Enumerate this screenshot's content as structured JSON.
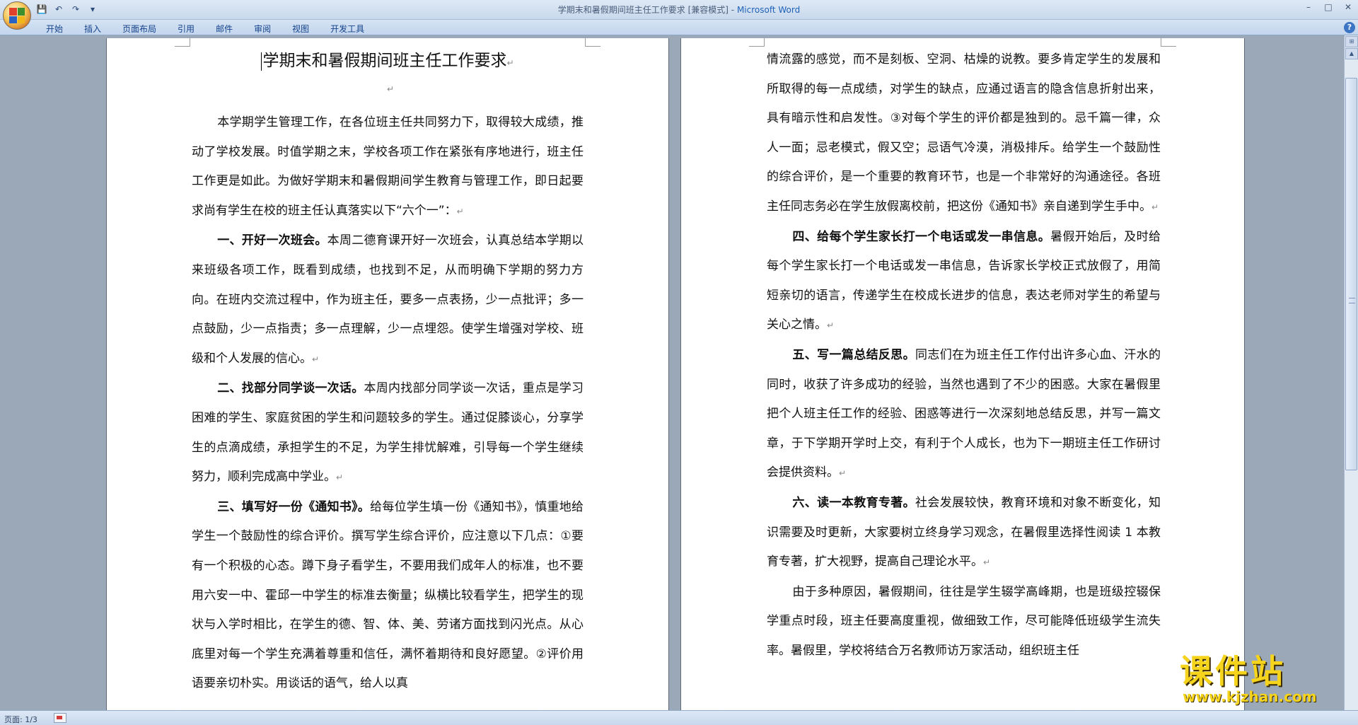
{
  "window": {
    "title_doc": "学期末和暑假期间班主任工作要求 [兼容模式]",
    "title_sep": " - ",
    "title_app": "Microsoft Word",
    "controls": [
      "–",
      "□",
      "✕"
    ]
  },
  "ribbon": {
    "tabs": [
      "开始",
      "插入",
      "页面布局",
      "引用",
      "邮件",
      "审阅",
      "视图",
      "开发工具"
    ],
    "help": "?"
  },
  "document": {
    "title": "学期末和暑假期间班主任工作要求",
    "pilcrow": "↵",
    "left_page": [
      {
        "bold": "",
        "text": "本学期学生管理工作，在各位班主任共同努力下，取得较大成绩，推动了学校发展。时值学期之末，学校各项工作在紧张有序地进行，班主任工作更是如此。为做好学期末和暑假期间学生教育与管理工作，即日起要求尚有学生在校的班主任认真落实以下“六个一”："
      },
      {
        "bold": "一、开好一次班会。",
        "text": "本周二德育课开好一次班会，认真总结本学期以来班级各项工作，既看到成绩，也找到不足，从而明确下学期的努力方向。在班内交流过程中，作为班主任，要多一点表扬，少一点批评；多一点鼓励，少一点指责；多一点理解，少一点埋怨。使学生增强对学校、班级和个人发展的信心。"
      },
      {
        "bold": "二、找部分同学谈一次话。",
        "text": "本周内找部分同学谈一次话，重点是学习困难的学生、家庭贫困的学生和问题较多的学生。通过促膝谈心，分享学生的点滴成绩，承担学生的不足，为学生排忧解难，引导每一个学生继续努力，顺利完成高中学业。"
      },
      {
        "bold": "三、填写好一份《通知书》。",
        "text": "给每位学生填一份《通知书》，慎重地给学生一个鼓励性的综合评价。撰写学生综合评价，应注意以下几点：①要有一个积极的心态。蹲下身子看学生，不要用我们成年人的标准，也不要用六安一中、霍邱一中学生的标准去衡量；纵横比较看学生，把学生的现状与入学时相比，在学生的德、智、体、美、劳诸方面找到闪光点。从心底里对每一个学生充满着尊重和信任，满怀着期待和良好愿望。②评价用语要亲切朴实。用谈话的语气，给人以真"
      }
    ],
    "right_page": [
      {
        "indent": false,
        "bold": "",
        "text": "情流露的感觉，而不是刻板、空洞、枯燥的说教。要多肯定学生的发展和所取得的每一点成绩，对学生的缺点，应通过语言的隐含信息折射出来，具有暗示性和启发性。③对每个学生的评价都是独到的。忌千篇一律，众人一面；忌老模式，假又空；忌语气冷漠，消极排斥。给学生一个鼓励性的综合评价，是一个重要的教育环节，也是一个非常好的沟通途径。各班主任同志务必在学生放假离校前，把这份《通知书》亲自递到学生手中。"
      },
      {
        "indent": true,
        "bold": "四、给每个学生家长打一个电话或发一串信息。",
        "text": "暑假开始后，及时给每个学生家长打一个电话或发一串信息，告诉家长学校正式放假了，用简短亲切的语言，传递学生在校成长进步的信息，表达老师对学生的希望与关心之情。"
      },
      {
        "indent": true,
        "bold": "五、写一篇总结反思。",
        "text": "同志们在为班主任工作付出许多心血、汗水的同时，收获了许多成功的经验，当然也遇到了不少的困惑。大家在暑假里把个人班主任工作的经验、困惑等进行一次深刻地总结反思，并写一篇文章，于下学期开学时上交，有利于个人成长，也为下一期班主任工作研讨会提供资料。"
      },
      {
        "indent": true,
        "bold": "六、读一本教育专著。",
        "text": "社会发展较快，教育环境和对象不断变化，知识需要及时更新，大家要树立终身学习观念，在暑假里选择性阅读 1 本教育专著，扩大视野，提高自己理论水平。"
      },
      {
        "indent": true,
        "bold": "",
        "text": "由于多种原因，暑假期间，往往是学生辍学高峰期，也是班级控辍保学重点时段，班主任要高度重视，做细致工作，尽可能降低班级学生流失率。暑假里，学校将结合万名教师访万家活动，组织班主任"
      }
    ]
  },
  "status": {
    "page": "页面: 1/3"
  },
  "watermark": {
    "cn": "课件站",
    "url": "www.kjzhan.com"
  }
}
